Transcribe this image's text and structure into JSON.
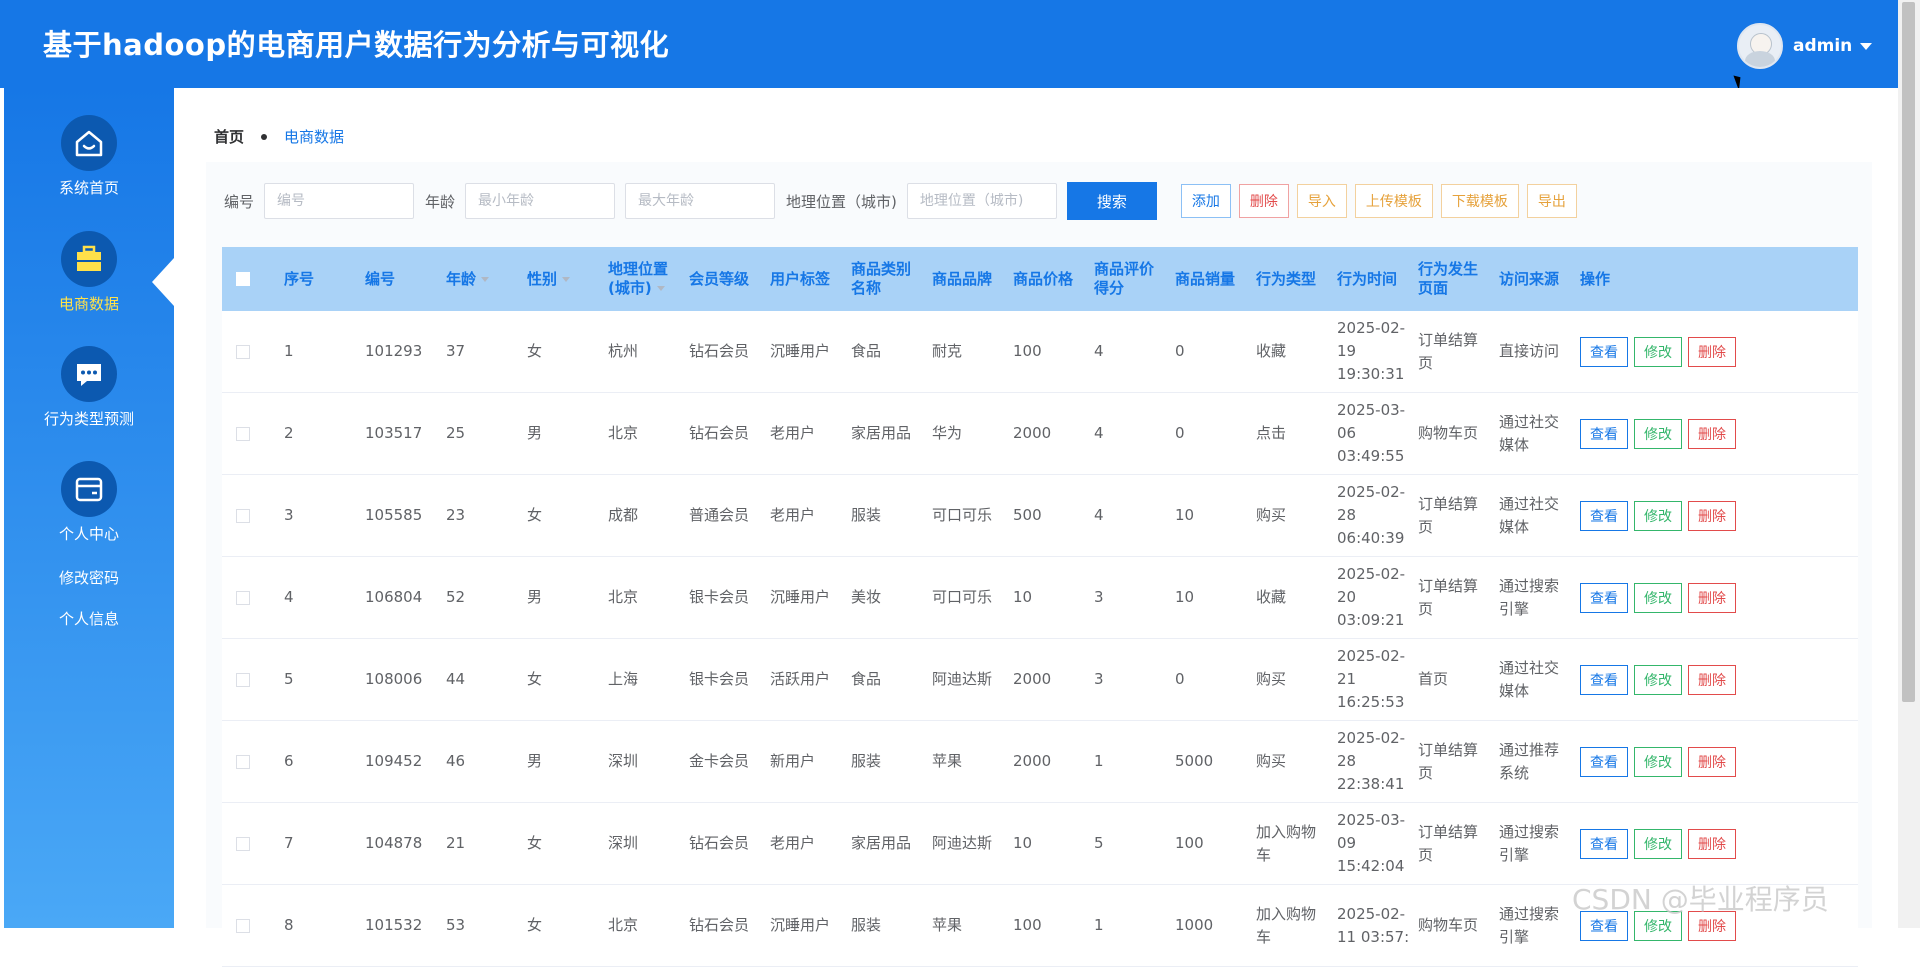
{
  "header": {
    "title": "基于hadoop的电商用户数据行为分析与可视化",
    "username": "admin"
  },
  "sidebar": {
    "items": [
      {
        "label": "系统首页",
        "icon": "home-icon"
      },
      {
        "label": "电商数据",
        "icon": "briefcase-icon",
        "active": true
      },
      {
        "label": "行为类型预测",
        "icon": "chat-icon"
      },
      {
        "label": "个人中心",
        "icon": "wallet-icon"
      }
    ],
    "sub_items": [
      "修改密码",
      "个人信息"
    ]
  },
  "breadcrumb": {
    "home": "首页",
    "current": "电商数据"
  },
  "filters": {
    "id_label": "编号",
    "id_placeholder": "编号",
    "age_label": "年龄",
    "age_min_placeholder": "最小年龄",
    "age_max_placeholder": "最大年龄",
    "location_label": "地理位置（城市)",
    "location_placeholder": "地理位置（城市)",
    "search_label": "搜索"
  },
  "actions": {
    "add": "添加",
    "delete": "删除",
    "import": "导入",
    "upload_template": "上传模板",
    "download_template": "下载模板",
    "export": "导出"
  },
  "table": {
    "columns": [
      "序号",
      "编号",
      "年龄",
      "性别",
      "地理位置(城市)",
      "会员等级",
      "用户标签",
      "商品类别名称",
      "商品品牌",
      "商品价格",
      "商品评价得分",
      "商品销量",
      "行为类型",
      "行为时间",
      "行为发生页面",
      "访问来源",
      "操作"
    ],
    "row_buttons": {
      "view": "查看",
      "edit": "修改",
      "delete": "删除"
    },
    "rows": [
      [
        "1",
        "101293",
        "37",
        "女",
        "杭州",
        "钻石会员",
        "沉睡用户",
        "食品",
        "耐克",
        "100",
        "4",
        "0",
        "收藏",
        "2025-02-19 19:30:31",
        "订单结算页",
        "直接访问"
      ],
      [
        "2",
        "103517",
        "25",
        "男",
        "北京",
        "钻石会员",
        "老用户",
        "家居用品",
        "华为",
        "2000",
        "4",
        "0",
        "点击",
        "2025-03-06 03:49:55",
        "购物车页",
        "通过社交媒体"
      ],
      [
        "3",
        "105585",
        "23",
        "女",
        "成都",
        "普通会员",
        "老用户",
        "服装",
        "可口可乐",
        "500",
        "4",
        "10",
        "购买",
        "2025-02-28 06:40:39",
        "订单结算页",
        "通过社交媒体"
      ],
      [
        "4",
        "106804",
        "52",
        "男",
        "北京",
        "银卡会员",
        "沉睡用户",
        "美妆",
        "可口可乐",
        "10",
        "3",
        "10",
        "收藏",
        "2025-02-20 03:09:21",
        "订单结算页",
        "通过搜索引擎"
      ],
      [
        "5",
        "108006",
        "44",
        "女",
        "上海",
        "银卡会员",
        "活跃用户",
        "食品",
        "阿迪达斯",
        "2000",
        "3",
        "0",
        "购买",
        "2025-02-21 16:25:53",
        "首页",
        "通过社交媒体"
      ],
      [
        "6",
        "109452",
        "46",
        "男",
        "深圳",
        "金卡会员",
        "新用户",
        "服装",
        "苹果",
        "2000",
        "1",
        "5000",
        "购买",
        "2025-02-28 22:38:41",
        "订单结算页",
        "通过推荐系统"
      ],
      [
        "7",
        "104878",
        "21",
        "女",
        "深圳",
        "钻石会员",
        "老用户",
        "家居用品",
        "阿迪达斯",
        "10",
        "5",
        "100",
        "加入购物车",
        "2025-03-09 15:42:04",
        "订单结算页",
        "通过搜索引擎"
      ],
      [
        "8",
        "101532",
        "53",
        "女",
        "北京",
        "钻石会员",
        "沉睡用户",
        "服装",
        "苹果",
        "100",
        "1",
        "1000",
        "加入购物车",
        "2025-02-11 03:57:",
        "购物车页",
        "通过搜索引擎"
      ]
    ]
  },
  "watermark": "CSDN @毕业程序员"
}
